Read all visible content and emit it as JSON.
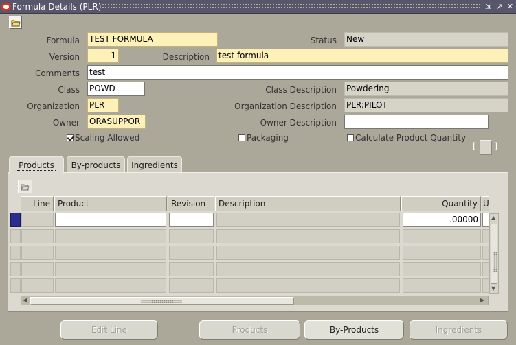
{
  "window": {
    "title": "Formula Details (PLR)",
    "controls": [
      "⇲",
      "↗",
      "✕"
    ]
  },
  "form": {
    "formula_label": "Formula",
    "formula_value": "TEST FORMULA",
    "status_label": "Status",
    "status_value": "New",
    "version_label": "Version",
    "version_value": "1",
    "description_label": "Description",
    "description_value": "test formula",
    "comments_label": "Comments",
    "comments_value": "test",
    "class_label": "Class",
    "class_value": "POWD",
    "class_desc_label": "Class Description",
    "class_desc_value": "Powdering",
    "org_label": "Organization",
    "org_value": "PLR",
    "org_desc_label": "Organization Description",
    "org_desc_value": "PLR:PILOT",
    "owner_label": "Owner",
    "owner_value": "ORASUPPOR",
    "owner_desc_label": "Owner Description",
    "owner_desc_value": "",
    "scaling_label": "Scaling Allowed",
    "scaling_checked": true,
    "packaging_label": "Packaging",
    "packaging_checked": false,
    "calc_label": "Calculate Product Quantity",
    "calc_checked": false
  },
  "bracket": {
    "left": "[",
    "right": "]"
  },
  "tabs": [
    {
      "label": "Products",
      "active": true
    },
    {
      "label": "By-products",
      "active": false
    },
    {
      "label": "Ingredients",
      "active": false
    }
  ],
  "grid": {
    "headers": {
      "line": "Line",
      "product": "Product",
      "revision": "Revision",
      "description": "Description",
      "quantity": "Quantity",
      "uom": "U"
    },
    "rows": [
      {
        "line": "",
        "product": "",
        "revision": "",
        "description": "",
        "quantity": ".00000",
        "current": true
      },
      {
        "line": "",
        "product": "",
        "revision": "",
        "description": "",
        "quantity": "",
        "current": false
      },
      {
        "line": "",
        "product": "",
        "revision": "",
        "description": "",
        "quantity": "",
        "current": false
      },
      {
        "line": "",
        "product": "",
        "revision": "",
        "description": "",
        "quantity": "",
        "current": false
      },
      {
        "line": "",
        "product": "",
        "revision": "",
        "description": "",
        "quantity": "",
        "current": false
      }
    ]
  },
  "buttons": {
    "edit_line": "Edit Line",
    "products": "Products",
    "by_products": "By-Products",
    "ingredients": "Ingredients"
  },
  "colors": {
    "required_field": "#fdf0b9",
    "readonly_field": "#d6d4c7",
    "current_row": "#2a2c8e",
    "background": "#aca899"
  }
}
